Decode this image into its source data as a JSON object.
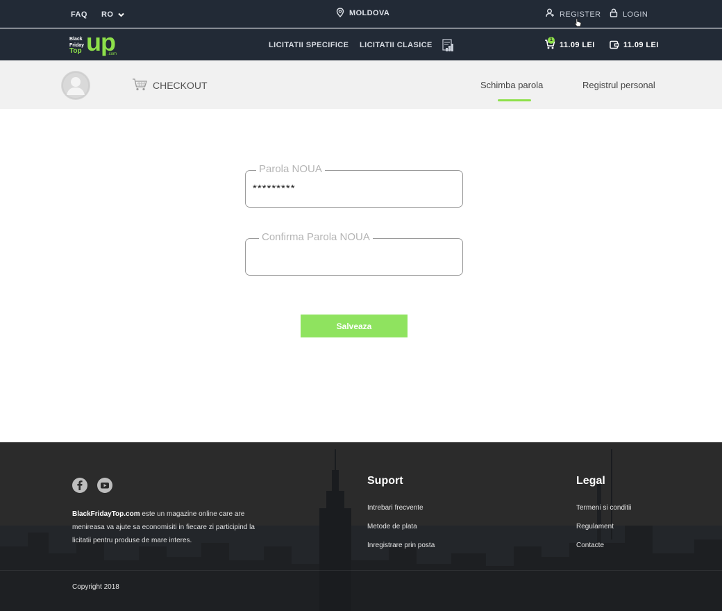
{
  "topbar": {
    "faq": "FAQ",
    "language": "RO",
    "location": "MOLDOVA",
    "register": "REGISTER",
    "login": "LOGIN"
  },
  "navbar": {
    "logo": {
      "line1": "Black",
      "line2": "Friday",
      "line3": "Top",
      "up": "up",
      "com": ".com"
    },
    "links": [
      "LICITATII SPECIFICE",
      "LICITATII CLASICE"
    ],
    "cart": {
      "badge": "1",
      "amount": "11.09 LEI"
    },
    "wallet": {
      "amount": "11.09 LEI"
    }
  },
  "profile": {
    "checkout": "CHECKOUT",
    "tabs": [
      "Schimba parola",
      "Registrul personal"
    ],
    "active_tab": "Schimba parola"
  },
  "form": {
    "new_password": {
      "label": "Parola NOUA",
      "value": "*********"
    },
    "confirm_password": {
      "label": "Confirma Parola NOUA",
      "value": ""
    },
    "save": "Salveaza"
  },
  "footer": {
    "about_brand": "BlackFridayTop.com",
    "about_text": " este un magazine online care are menireasa va ajute sa economisiti in fiecare zi participind la licitatii pentru produse de mare interes.",
    "support": {
      "title": "Suport",
      "links": [
        "Intrebari frecvente",
        "Metode de plata",
        "Inregistrare prin posta"
      ]
    },
    "legal": {
      "title": "Legal",
      "links": [
        "Termeni si conditii",
        "Regulament",
        "Contacte"
      ]
    },
    "copyright": "Copyright 2018"
  },
  "colors": {
    "accent": "#8de04a",
    "header_bg": "#222a36",
    "button_bg": "#8fe35f"
  }
}
